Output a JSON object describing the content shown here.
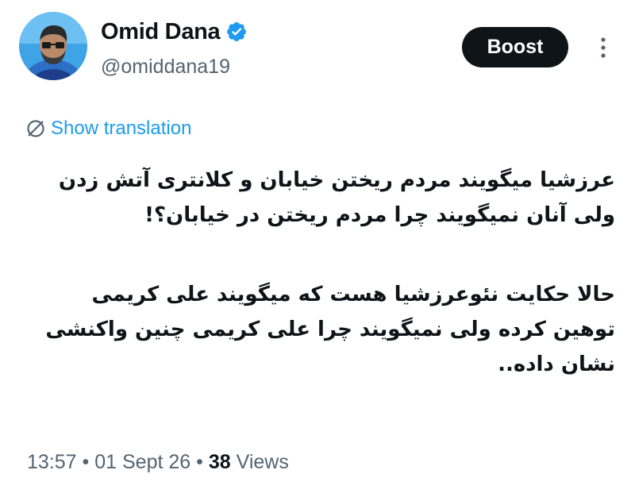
{
  "author": {
    "display_name": "Omid Dana",
    "handle": "@omiddana19",
    "verified": true,
    "avatar_icon": "profile-photo"
  },
  "actions": {
    "boost_label": "Boost",
    "more_icon": "vertical-ellipsis-icon"
  },
  "translation": {
    "label": "Show translation",
    "icon": "globe-icon"
  },
  "tweet": {
    "paragraphs": [
      "عرزشیا میگویند مردم ریختن خیابان و کلانتری آتش زدن ولی آنان نمیگویند چرا مردم ریختن در خیابان؟!",
      "حالا حکایت نئوعرزشیا هست که میگویند علی کریمی توهین کرده ولی نمیگویند چرا علی کریمی چنین واکنشی نشان داده.."
    ]
  },
  "meta": {
    "time": "13:57",
    "separator": "•",
    "date": "01 Sept 26",
    "views_count": "38",
    "views_label": "Views"
  },
  "colors": {
    "text": "#0f1419",
    "secondary": "#536471",
    "link": "#1d9bf0",
    "verified_badge": "#1d9bf0",
    "boost_bg": "#0f1419"
  }
}
